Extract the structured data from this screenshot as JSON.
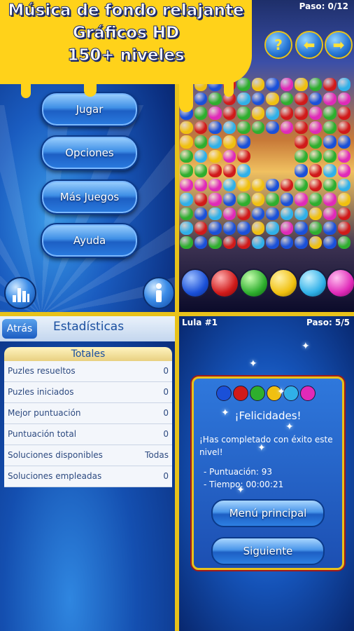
{
  "banner": {
    "line1": "Música de fondo relajante",
    "line2": "Gráficos HD",
    "line3": "150+ niveles"
  },
  "main_menu": {
    "buttons": [
      "Jugar",
      "Opciones",
      "Más Juegos",
      "Ayuda"
    ],
    "stats_icon": "bar-chart-icon",
    "info_icon": "info-icon"
  },
  "puzzle": {
    "step": "Paso: 0/12",
    "help_label": "?",
    "back_arrow": "arrow-left-icon",
    "forward_arrow": "arrow-right-icon",
    "colors": [
      "#1a50d8",
      "#d01a1a",
      "#2eae2e",
      "#f0c010",
      "#30b0e8",
      "#e02ab8"
    ]
  },
  "stats": {
    "back_label": "Atrás",
    "title": "Estadísticas",
    "section": "Totales",
    "rows": [
      {
        "label": "Puzles resueltos",
        "value": "0"
      },
      {
        "label": "Puzles iniciados",
        "value": "0"
      },
      {
        "label": "Mejor puntuación",
        "value": "0"
      },
      {
        "label": "Puntuación total",
        "value": "0"
      },
      {
        "label": "Soluciones disponibles",
        "value": "Todas"
      },
      {
        "label": "Soluciones empleadas",
        "value": "0"
      }
    ]
  },
  "complete": {
    "level": "Lula #1",
    "step": "Paso: 5/5",
    "title": "¡Felicidades!",
    "message": "¡Has completado con éxito este nivel!",
    "score": "- Puntuación: 93",
    "time": "- Tiempo: 00:00:21",
    "main_menu_btn": "Menú principal",
    "next_btn": "Siguiente"
  }
}
